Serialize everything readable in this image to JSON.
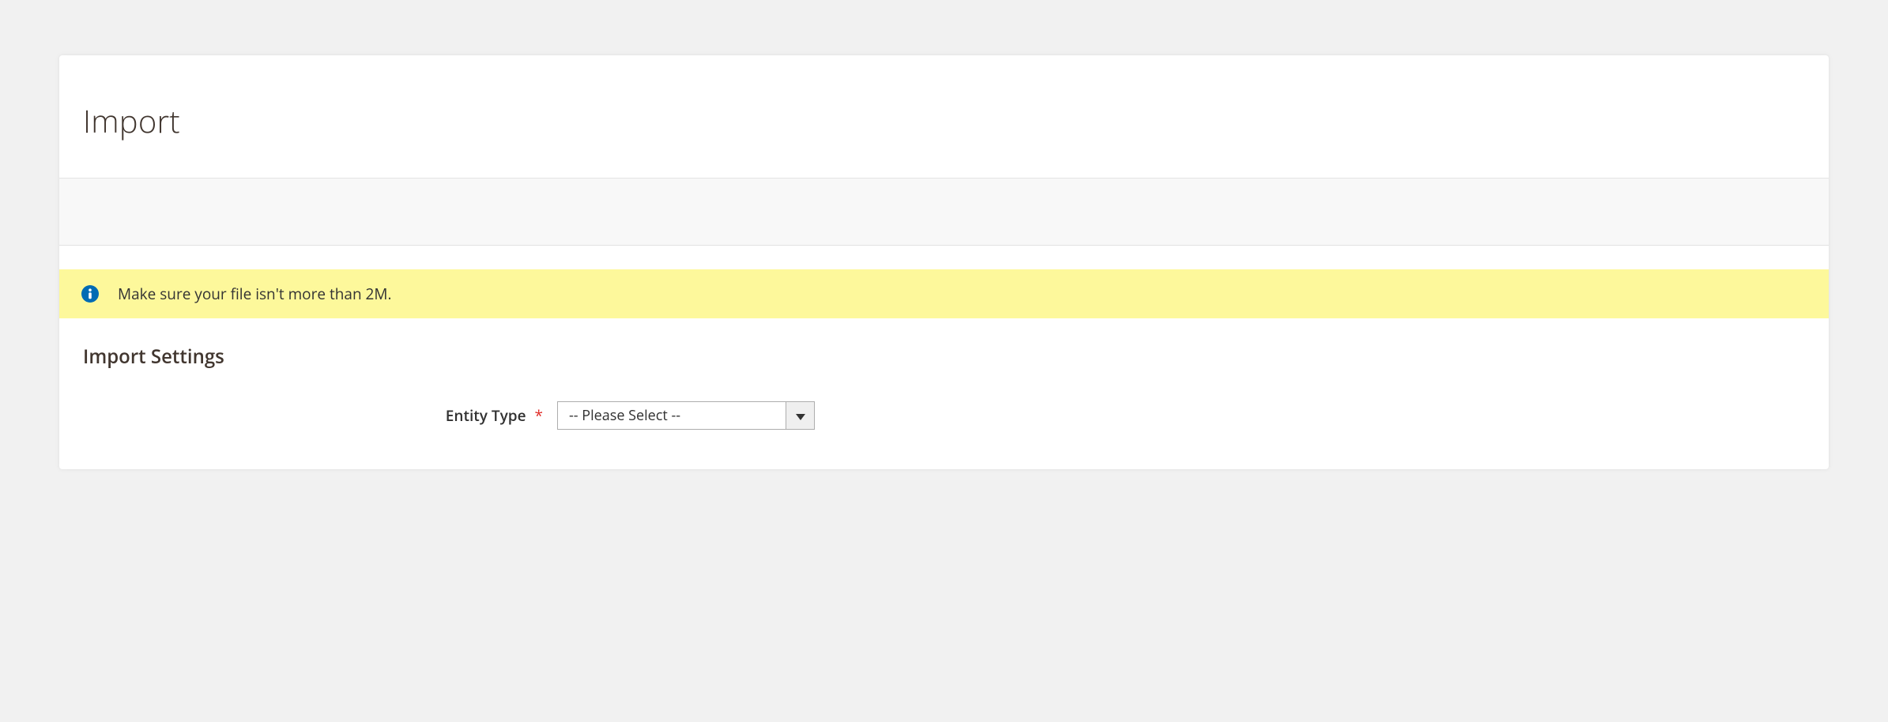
{
  "page": {
    "title": "Import"
  },
  "notice": {
    "message": "Make sure your file isn't more than 2M."
  },
  "section": {
    "title": "Import Settings"
  },
  "form": {
    "entity_type": {
      "label": "Entity Type",
      "required_mark": "*",
      "selected": "-- Please Select --"
    }
  }
}
